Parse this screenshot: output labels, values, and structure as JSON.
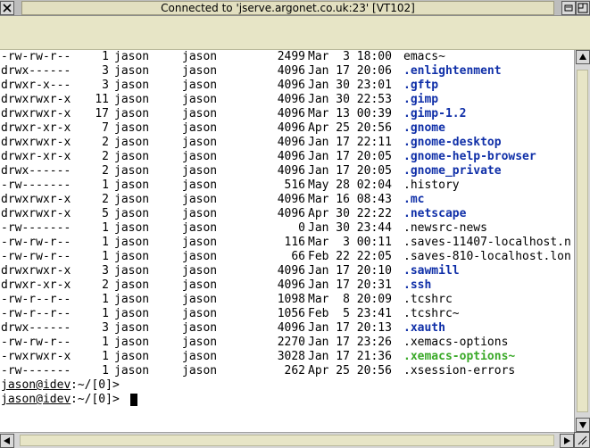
{
  "window": {
    "title": "Connected to 'jserve.argonet.co.uk:23' [VT102]",
    "icons": [
      "close-icon",
      "iconise-icon",
      "toggle-size-icon"
    ]
  },
  "colors": {
    "dir_blue": "#0f2fa8",
    "exec_green": "#3aa928",
    "toolbar": "#e7e5c6"
  },
  "listing": [
    {
      "perm": "-rw-rw-r--",
      "links": "1",
      "owner": "jason",
      "group": "jason",
      "size": "2499",
      "date": "Mar  3 18:00",
      "name": "emacs~",
      "color": "plain"
    },
    {
      "perm": "drwx------",
      "links": "3",
      "owner": "jason",
      "group": "jason",
      "size": "4096",
      "date": "Jan 17 20:06",
      "name": ".enlightenment",
      "color": "blue"
    },
    {
      "perm": "drwxr-x---",
      "links": "3",
      "owner": "jason",
      "group": "jason",
      "size": "4096",
      "date": "Jan 30 23:01",
      "name": ".gftp",
      "color": "blue"
    },
    {
      "perm": "drwxrwxr-x",
      "links": "11",
      "owner": "jason",
      "group": "jason",
      "size": "4096",
      "date": "Jan 30 22:53",
      "name": ".gimp",
      "color": "blue"
    },
    {
      "perm": "drwxrwxr-x",
      "links": "17",
      "owner": "jason",
      "group": "jason",
      "size": "4096",
      "date": "Mar 13 00:39",
      "name": ".gimp-1.2",
      "color": "blue"
    },
    {
      "perm": "drwxr-xr-x",
      "links": "7",
      "owner": "jason",
      "group": "jason",
      "size": "4096",
      "date": "Apr 25 20:56",
      "name": ".gnome",
      "color": "blue"
    },
    {
      "perm": "drwxrwxr-x",
      "links": "2",
      "owner": "jason",
      "group": "jason",
      "size": "4096",
      "date": "Jan 17 22:11",
      "name": ".gnome-desktop",
      "color": "blue"
    },
    {
      "perm": "drwxr-xr-x",
      "links": "2",
      "owner": "jason",
      "group": "jason",
      "size": "4096",
      "date": "Jan 17 20:05",
      "name": ".gnome-help-browser",
      "color": "blue"
    },
    {
      "perm": "drwx------",
      "links": "2",
      "owner": "jason",
      "group": "jason",
      "size": "4096",
      "date": "Jan 17 20:05",
      "name": ".gnome_private",
      "color": "blue"
    },
    {
      "perm": "-rw-------",
      "links": "1",
      "owner": "jason",
      "group": "jason",
      "size": "516",
      "date": "May 28 02:04",
      "name": ".history",
      "color": "plain"
    },
    {
      "perm": "drwxrwxr-x",
      "links": "2",
      "owner": "jason",
      "group": "jason",
      "size": "4096",
      "date": "Mar 16 08:43",
      "name": ".mc",
      "color": "blue"
    },
    {
      "perm": "drwxrwxr-x",
      "links": "5",
      "owner": "jason",
      "group": "jason",
      "size": "4096",
      "date": "Apr 30 22:22",
      "name": ".netscape",
      "color": "blue"
    },
    {
      "perm": "-rw-------",
      "links": "1",
      "owner": "jason",
      "group": "jason",
      "size": "0",
      "date": "Jan 30 23:44",
      "name": ".newsrc-news",
      "color": "plain"
    },
    {
      "perm": "-rw-rw-r--",
      "links": "1",
      "owner": "jason",
      "group": "jason",
      "size": "116",
      "date": "Mar  3 00:11",
      "name": ".saves-11407-localhost.n",
      "color": "plain"
    },
    {
      "perm": "-rw-rw-r--",
      "links": "1",
      "owner": "jason",
      "group": "jason",
      "size": "66",
      "date": "Feb 22 22:05",
      "name": ".saves-810-localhost.lon",
      "color": "plain"
    },
    {
      "perm": "drwxrwxr-x",
      "links": "3",
      "owner": "jason",
      "group": "jason",
      "size": "4096",
      "date": "Jan 17 20:10",
      "name": ".sawmill",
      "color": "blue"
    },
    {
      "perm": "drwxr-xr-x",
      "links": "2",
      "owner": "jason",
      "group": "jason",
      "size": "4096",
      "date": "Jan 17 20:31",
      "name": ".ssh",
      "color": "blue"
    },
    {
      "perm": "-rw-r--r--",
      "links": "1",
      "owner": "jason",
      "group": "jason",
      "size": "1098",
      "date": "Mar  8 20:09",
      "name": ".tcshrc",
      "color": "plain"
    },
    {
      "perm": "-rw-r--r--",
      "links": "1",
      "owner": "jason",
      "group": "jason",
      "size": "1056",
      "date": "Feb  5 23:41",
      "name": ".tcshrc~",
      "color": "plain"
    },
    {
      "perm": "drwx------",
      "links": "3",
      "owner": "jason",
      "group": "jason",
      "size": "4096",
      "date": "Jan 17 20:13",
      "name": ".xauth",
      "color": "blue"
    },
    {
      "perm": "-rw-rw-r--",
      "links": "1",
      "owner": "jason",
      "group": "jason",
      "size": "2270",
      "date": "Jan 17 23:26",
      "name": ".xemacs-options",
      "color": "plain"
    },
    {
      "perm": "-rwxrwxr-x",
      "links": "1",
      "owner": "jason",
      "group": "jason",
      "size": "3028",
      "date": "Jan 17 21:36",
      "name": ".xemacs-options~",
      "color": "green"
    },
    {
      "perm": "-rw-------",
      "links": "1",
      "owner": "jason",
      "group": "jason",
      "size": "262",
      "date": "Apr 25 20:56",
      "name": ".xsession-errors",
      "color": "plain"
    }
  ],
  "prompts": [
    {
      "user_host": "jason@idev",
      "path": ":~/[0]>"
    },
    {
      "user_host": "jason@idev",
      "path": ":~/[0]>"
    }
  ]
}
